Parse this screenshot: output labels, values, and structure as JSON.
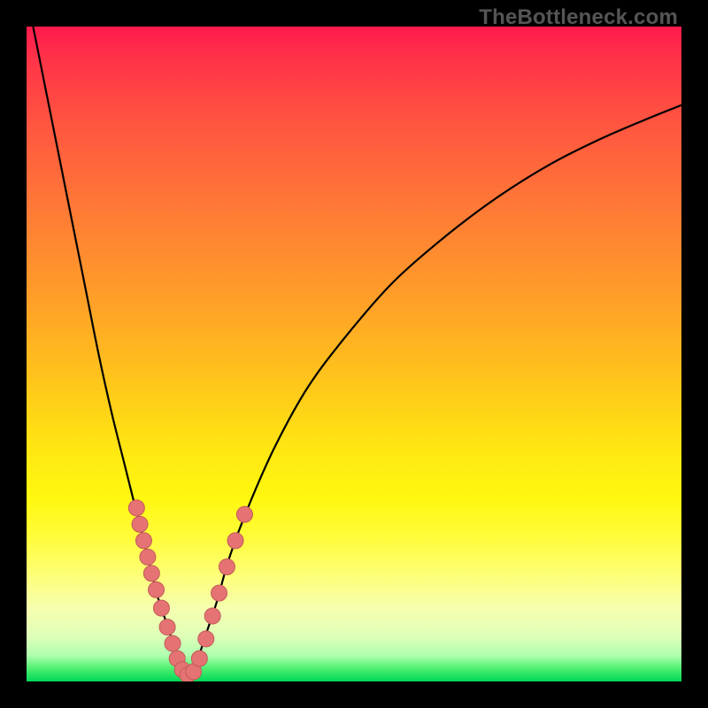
{
  "watermark": "TheBottleneck.com",
  "colors": {
    "frame_bg_top": "#ff1a4d",
    "frame_bg_bottom": "#00d858",
    "curve_stroke": "#000000",
    "marker_fill": "#e57373",
    "marker_stroke": "#c35a5a",
    "page_bg": "#000000"
  },
  "chart_data": {
    "type": "line",
    "title": "",
    "xlabel": "",
    "ylabel": "",
    "xlim": [
      0,
      100
    ],
    "ylim": [
      0,
      100
    ],
    "grid": false,
    "legend": false,
    "series": [
      {
        "name": "left-branch",
        "x": [
          1,
          3,
          5,
          7,
          9,
          11,
          13,
          15,
          17,
          19,
          20,
          21,
          22,
          23,
          23.6
        ],
        "y": [
          100,
          90,
          80,
          70,
          60,
          50,
          41,
          33,
          25,
          17,
          13,
          10,
          7,
          4,
          1
        ]
      },
      {
        "name": "right-branch",
        "x": [
          25.5,
          27,
          29,
          31,
          34,
          38,
          43,
          49,
          56,
          64,
          72,
          80,
          88,
          95,
          100
        ],
        "y": [
          1,
          6,
          12,
          19,
          27,
          36,
          45,
          53,
          61,
          68,
          74,
          79,
          83,
          86,
          88
        ]
      }
    ],
    "markers": [
      {
        "x": 16.8,
        "y": 26.5
      },
      {
        "x": 17.3,
        "y": 24.0
      },
      {
        "x": 17.9,
        "y": 21.5
      },
      {
        "x": 18.5,
        "y": 19.0
      },
      {
        "x": 19.1,
        "y": 16.5
      },
      {
        "x": 19.8,
        "y": 14.0
      },
      {
        "x": 20.6,
        "y": 11.2
      },
      {
        "x": 21.5,
        "y": 8.3
      },
      {
        "x": 22.3,
        "y": 5.8
      },
      {
        "x": 23.0,
        "y": 3.5
      },
      {
        "x": 23.8,
        "y": 1.8
      },
      {
        "x": 24.6,
        "y": 1.0
      },
      {
        "x": 25.5,
        "y": 1.5
      },
      {
        "x": 26.4,
        "y": 3.5
      },
      {
        "x": 27.4,
        "y": 6.5
      },
      {
        "x": 28.4,
        "y": 10.0
      },
      {
        "x": 29.4,
        "y": 13.5
      },
      {
        "x": 30.6,
        "y": 17.5
      },
      {
        "x": 31.9,
        "y": 21.5
      },
      {
        "x": 33.3,
        "y": 25.5
      }
    ]
  }
}
